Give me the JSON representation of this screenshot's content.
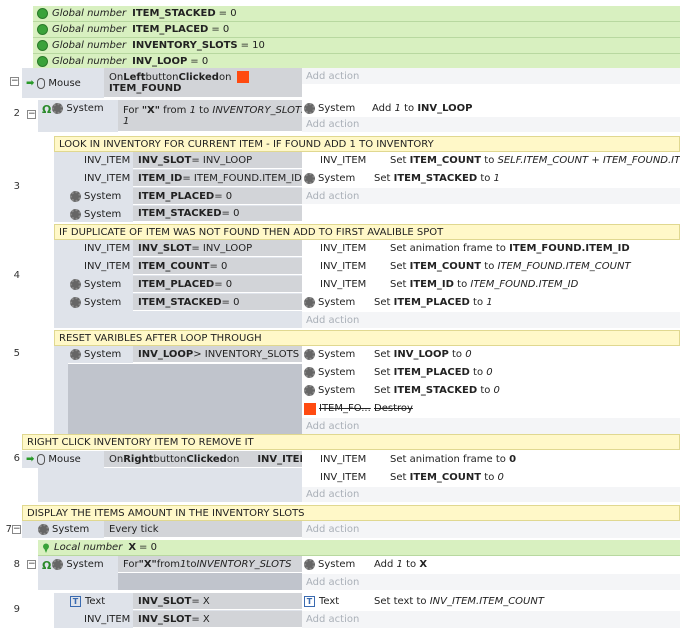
{
  "globals": [
    {
      "kw": "Global number",
      "name": "ITEM_STACKED",
      "val": " = 0"
    },
    {
      "kw": "Global number",
      "name": "ITEM_PLACED",
      "val": " = 0"
    },
    {
      "kw": "Global number",
      "name": "INVENTORY_SLOTS",
      "val": " = 10"
    },
    {
      "kw": "Global number",
      "name": "INV_LOOP",
      "val": " = 0"
    }
  ],
  "add_action": "Add action",
  "ev1": {
    "num": "1",
    "obj": "Mouse",
    "c1": "On ",
    "c2": "Left",
    "c3": " button ",
    "c4": "Clicked",
    "c5": " on",
    "c6": "ITEM_FOUND"
  },
  "ev2": {
    "num": "2",
    "obj": "System",
    "c1": "For ",
    "c2": "\"X\"",
    "c3": " from ",
    "c4": "1",
    "c5": " to ",
    "c6": "INVENTORY_SLOTS +",
    "c7": "1",
    "a_obj": "System",
    "a1": "Add ",
    "a2": "1",
    "a3": " to ",
    "a4": "INV_LOOP"
  },
  "ev3": {
    "num": "3",
    "comment": "LOOK IN INVENTORY FOR CURRENT ITEM - IF FOUND ADD 1 TO INVENTORY",
    "conds": [
      {
        "obj": "INV_ITEM",
        "b": "INV_SLOT",
        "r": " = INV_LOOP"
      },
      {
        "obj": "INV_ITEM",
        "b": "ITEM_ID",
        "r": " = ITEM_FOUND.ITEM_ID"
      },
      {
        "obj": "System",
        "b": "ITEM_PLACED",
        "r": " = 0"
      },
      {
        "obj": "System",
        "b": "ITEM_STACKED",
        "r": " = 0"
      }
    ],
    "acts": [
      {
        "obj": "INV_ITEM",
        "t1": "Set ",
        "b": "ITEM_COUNT",
        "t2": " to ",
        "i": "SELF.ITEM_COUNT + ITEM_FOUND.ITEM_COUNT"
      },
      {
        "obj": "System",
        "t1": "Set ",
        "b": "ITEM_STACKED",
        "t2": " to ",
        "i": "1"
      }
    ]
  },
  "ev4": {
    "num": "4",
    "comment": "IF DUPLICATE OF ITEM WAS NOT FOUND THEN ADD TO FIRST AVALIBLE SPOT",
    "conds": [
      {
        "obj": "INV_ITEM",
        "b": "INV_SLOT",
        "r": " = INV_LOOP"
      },
      {
        "obj": "INV_ITEM",
        "b": "ITEM_COUNT",
        "r": " = 0"
      },
      {
        "obj": "System",
        "b": "ITEM_PLACED",
        "r": " = 0"
      },
      {
        "obj": "System",
        "b": "ITEM_STACKED",
        "r": " = 0"
      }
    ],
    "acts": [
      {
        "obj": "INV_ITEM",
        "t1": "Set animation frame to ",
        "b": "ITEM_FOUND.ITEM_ID",
        "t2": "",
        "i": ""
      },
      {
        "obj": "INV_ITEM",
        "t1": "Set ",
        "b": "ITEM_COUNT",
        "t2": " to ",
        "i": "ITEM_FOUND.ITEM_COUNT"
      },
      {
        "obj": "INV_ITEM",
        "t1": "Set ",
        "b": "ITEM_ID",
        "t2": " to ",
        "i": "ITEM_FOUND.ITEM_ID"
      },
      {
        "obj": "System",
        "t1": "Set ",
        "b": "ITEM_PLACED",
        "t2": " to ",
        "i": "1"
      }
    ]
  },
  "ev5": {
    "num": "5",
    "comment": "RESET VARIBLES AFTER LOOP THROUGH",
    "cond": {
      "obj": "System",
      "b": "INV_LOOP",
      "r": " > INVENTORY_SLOTS"
    },
    "acts": [
      {
        "obj": "System",
        "t1": "Set ",
        "b": "INV_LOOP",
        "t2": " to ",
        "i": "0"
      },
      {
        "obj": "System",
        "t1": "Set ",
        "b": "ITEM_PLACED",
        "t2": " to ",
        "i": "0"
      },
      {
        "obj": "System",
        "t1": "Set ",
        "b": "ITEM_STACKED",
        "t2": " to ",
        "i": "0"
      }
    ],
    "destroy_obj": "ITEM_FO...",
    "destroy": "Destroy"
  },
  "ev6": {
    "num": "6",
    "comment": "RIGHT CLICK INVENTORY ITEM TO REMOVE IT",
    "obj": "Mouse",
    "c1": "On ",
    "c2": "Right",
    "c3": " button ",
    "c4": "Clicked",
    "c5": " on",
    "c6": "INV_ITEM",
    "acts": [
      {
        "obj": "INV_ITEM",
        "t1": "Set animation frame to ",
        "b": "0",
        "t2": "",
        "i": ""
      },
      {
        "obj": "INV_ITEM",
        "t1": "Set ",
        "b": "ITEM_COUNT",
        "t2": " to ",
        "i": "0"
      }
    ]
  },
  "ev7": {
    "num": "7",
    "comment": "DISPLAY THE ITEMS AMOUNT IN THE INVENTORY SLOTS",
    "obj": "System",
    "cond": "Every tick",
    "local_kw": "Local number",
    "local_name": "X",
    "local_val": " = 0"
  },
  "ev8": {
    "num": "8",
    "obj": "System",
    "c1": "For ",
    "c2": "\"X\"",
    "c3": " from ",
    "c4": "1",
    "c5": " to ",
    "c6": "INVENTORY_SLOTS",
    "a_obj": "System",
    "a1": "Add ",
    "a2": "1",
    "a3": " to ",
    "a4": "X"
  },
  "ev9": {
    "num": "9",
    "conds": [
      {
        "obj": "Text",
        "b": "INV_SLOT",
        "r": " = X"
      },
      {
        "obj": "INV_ITEM",
        "b": "INV_SLOT",
        "r": " = X"
      }
    ],
    "a_obj": "Text",
    "a1": "Set text to ",
    "a2": "INV_ITEM.ITEM_COUNT"
  },
  "colors": {
    "global_bg": "#d8f0c0",
    "comment_bg": "#fff8c8",
    "cond_bg": "#d2d4d8",
    "accent_red": "#ff4a10"
  }
}
